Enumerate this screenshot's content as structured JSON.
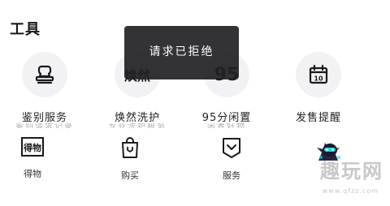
{
  "section": {
    "title": "工具"
  },
  "tools": [
    {
      "label": "鉴别服务",
      "sublabel": "鉴别请求记录",
      "icon": "stamp-icon"
    },
    {
      "label": "焕然洗护",
      "sublabel": "专业洗护服务",
      "icon_text": "焕然",
      "icon": "huanran-logo"
    },
    {
      "label": "95分闲置",
      "sublabel": "闲置好物",
      "icon_text": "95",
      "icon": "95-logo"
    },
    {
      "label": "发售提醒",
      "icon": "calendar-icon",
      "calendar_day": "10"
    }
  ],
  "toast": {
    "text": "请求已拒绝"
  },
  "tabs": [
    {
      "label": "得物",
      "icon": "dewu-logo-icon",
      "icon_text": "得物"
    },
    {
      "label": "购买",
      "icon": "shopping-bag-icon"
    },
    {
      "label": "服务",
      "icon": "shield-icon"
    },
    {
      "label": "",
      "icon": "avatar-character-icon"
    }
  ],
  "watermark": {
    "text": "趣玩网",
    "url": "www.qfzz.com"
  },
  "colors": {
    "accent_cyan": "#29d6d6",
    "toast_bg": "#222224",
    "icon_bg": "#f2f2f4"
  }
}
